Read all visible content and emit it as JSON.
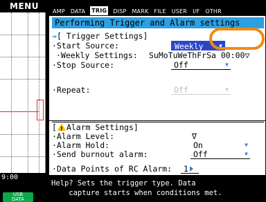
{
  "menu_label": "MENU",
  "graph": {
    "time_label": "9:00"
  },
  "usb": {
    "line1": "USB",
    "line2": "DATA"
  },
  "tabs": [
    {
      "label": "AMP",
      "active": false
    },
    {
      "label": "DATA",
      "active": false
    },
    {
      "label": "TRIG",
      "active": true
    },
    {
      "label": "DISP",
      "active": false
    },
    {
      "label": "MARK",
      "active": false
    },
    {
      "label": "FILE",
      "active": false
    },
    {
      "label": "USER",
      "active": false
    },
    {
      "label": "I/F",
      "active": false
    },
    {
      "label": "OTHR",
      "active": false
    }
  ],
  "title": "Performing Trigger and Alarm settings",
  "trigger": {
    "heading": "[ Trigger Settings]",
    "start_label": "·Start Source:",
    "start_value": "Weekly",
    "weekly_label": "·Weekly Settings:",
    "weekly_value": "SuMoTuWeThFrSa 00:00",
    "stop_label": "·Stop Source:",
    "stop_value": "Off",
    "repeat_label": "·Repeat:",
    "repeat_value": "Off"
  },
  "alarm": {
    "heading": "Alarm Settings]",
    "level_label": "·Alarm Level:",
    "level_value": "∇",
    "hold_label": "·Alarm Hold:",
    "hold_value": "On",
    "burnout_label": "·Send burnout alarm:",
    "burnout_value": "Off",
    "points_label": "·Data Points of RC Alarm:",
    "points_value": "1"
  },
  "help": {
    "line1": "Help? Sets the trigger type. Data",
    "line2": "    capture starts when conditions met."
  },
  "colors": {
    "title_bg": "#2ea0e0",
    "selected_bg": "#2c45c8",
    "highlight_ring": "#f08a12",
    "trace": "#e0282e",
    "usb_badge": "#0aa84a"
  }
}
